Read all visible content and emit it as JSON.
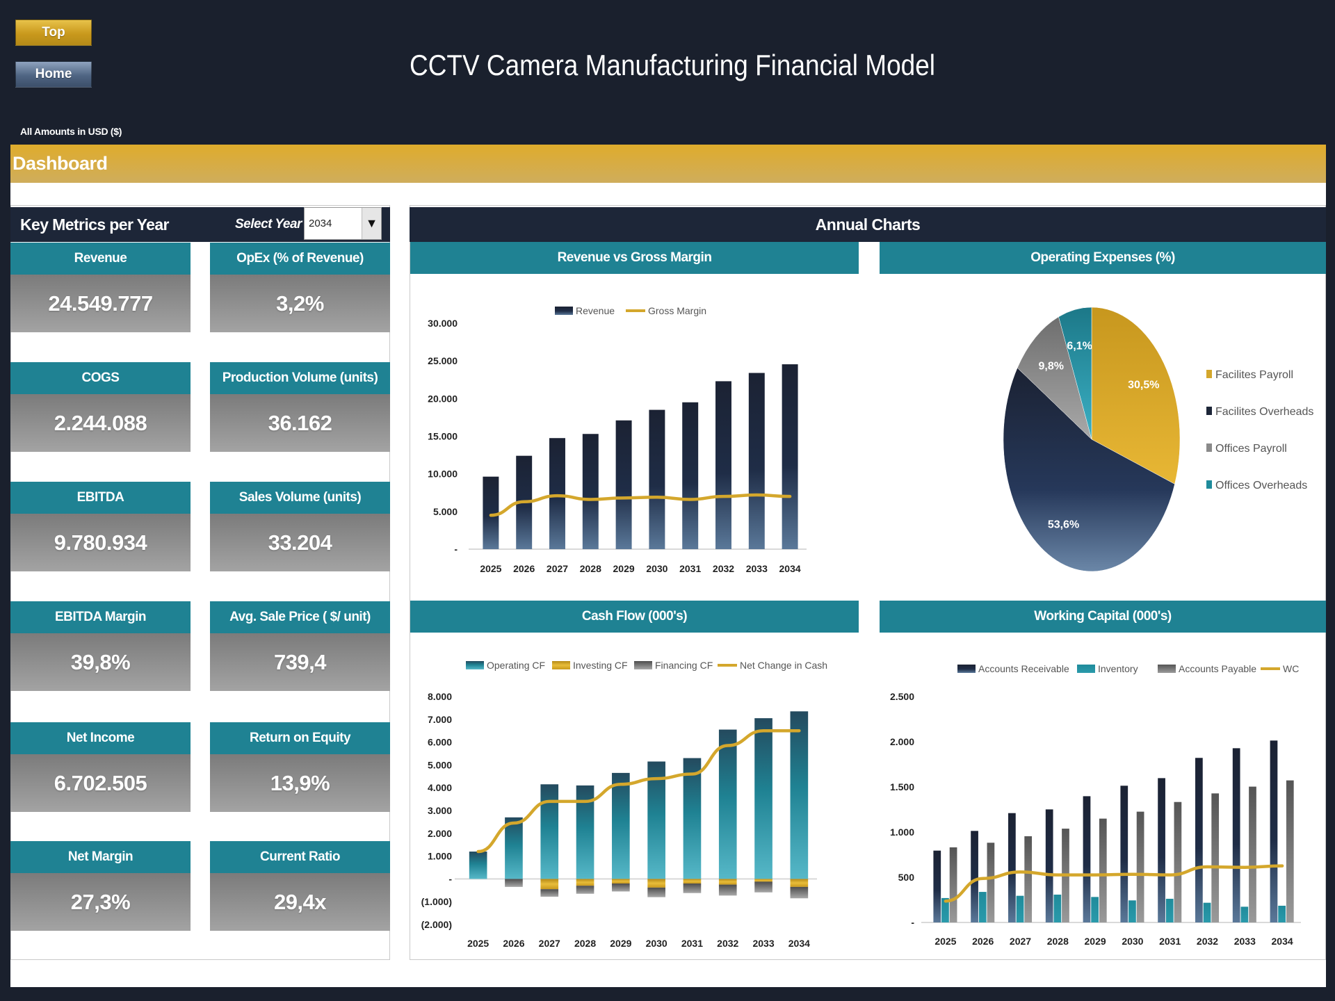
{
  "header": {
    "title": "CCTV Camera Manufacturing Financial Model",
    "buttons": {
      "top": "Top",
      "home": "Home"
    },
    "currency_note": "All Amounts in  USD ($)",
    "section_title": "Dashboard"
  },
  "colors": {
    "navy": "#1d2638",
    "teal": "#1f8293",
    "gold": "#d4a72c",
    "gray": "#8a8a8a",
    "background": "#1a202d"
  },
  "key_metrics": {
    "title": "Key Metrics per Year",
    "select_label": "Select Year",
    "selected_year": "2034",
    "items": [
      {
        "label": "Revenue",
        "value": "24.549.777"
      },
      {
        "label": "OpEx (% of Revenue)",
        "value": "3,2%"
      },
      {
        "label": "COGS",
        "value": "2.244.088"
      },
      {
        "label": "Production Volume (units)",
        "value": "36.162"
      },
      {
        "label": "EBITDA",
        "value": "9.780.934"
      },
      {
        "label": "Sales Volume (units)",
        "value": "33.204"
      },
      {
        "label": "EBITDA Margin",
        "value": "39,8%"
      },
      {
        "label": "Avg. Sale Price ( $/ unit)",
        "value": "739,4"
      },
      {
        "label": "Net Income",
        "value": "6.702.505"
      },
      {
        "label": "Return on Equity",
        "value": "13,9%"
      },
      {
        "label": "Net Margin",
        "value": "27,3%"
      },
      {
        "label": "Current Ratio",
        "value": "29,4x"
      }
    ]
  },
  "annual_charts_title": "Annual Charts",
  "chart_data": [
    {
      "id": "revenue",
      "type": "bar",
      "title": "Revenue vs Gross Margin",
      "categories": [
        "2025",
        "2026",
        "2027",
        "2028",
        "2029",
        "2030",
        "2031",
        "2032",
        "2033",
        "2034"
      ],
      "series": [
        {
          "name": "Revenue",
          "kind": "bar",
          "values": [
            9630,
            12400,
            14750,
            15300,
            17100,
            18500,
            19500,
            22300,
            23400,
            24550
          ]
        },
        {
          "name": "Gross Margin",
          "kind": "line",
          "values": [
            4500,
            6300,
            7100,
            6600,
            6800,
            6900,
            6600,
            7000,
            7200,
            7000
          ]
        }
      ],
      "yticks": [
        "-",
        "5.000",
        "10.000",
        "15.000",
        "20.000",
        "25.000",
        "30.000"
      ],
      "ylim": [
        0,
        30000
      ],
      "legend": "top"
    },
    {
      "id": "opex",
      "type": "pie",
      "title": "Operating Expenses (%)",
      "labels": [
        "Facilites Payroll",
        "Facilites Overheads",
        "Offices Payroll",
        "Offices Overheads"
      ],
      "values": [
        30.5,
        53.6,
        9.8,
        6.1
      ],
      "data_labels": [
        "30,5%",
        "53,6%",
        "9,8%",
        "6,1%"
      ],
      "legend": "right"
    },
    {
      "id": "cashflow",
      "type": "bar",
      "title": "Cash Flow (000's)",
      "categories": [
        "2025",
        "2026",
        "2027",
        "2028",
        "2029",
        "2030",
        "2031",
        "2032",
        "2033",
        "2034"
      ],
      "series": [
        {
          "name": "Operating CF",
          "kind": "bar",
          "values": [
            1200,
            2700,
            4150,
            4100,
            4650,
            5150,
            5300,
            6550,
            7050,
            7350
          ]
        },
        {
          "name": "Investing CF",
          "kind": "bar",
          "values": [
            0,
            0,
            -450,
            -300,
            -200,
            -380,
            -200,
            -250,
            -120,
            -350
          ]
        },
        {
          "name": "Financing CF",
          "kind": "bar",
          "values": [
            0,
            -350,
            -330,
            -350,
            -350,
            -420,
            -420,
            -480,
            -470,
            -500
          ]
        },
        {
          "name": "Net Change in Cash",
          "kind": "line",
          "values": [
            1200,
            2450,
            3400,
            3400,
            4150,
            4400,
            4600,
            5850,
            6500,
            6500
          ]
        }
      ],
      "yticks": [
        "(2.000)",
        "(1.000)",
        "-",
        "1.000",
        "2.000",
        "3.000",
        "4.000",
        "5.000",
        "6.000",
        "7.000",
        "8.000"
      ],
      "ylim": [
        -2000,
        8000
      ],
      "legend": "top"
    },
    {
      "id": "workingcapital",
      "type": "bar",
      "title": "Working Capital (000's)",
      "categories": [
        "2025",
        "2026",
        "2027",
        "2028",
        "2029",
        "2030",
        "2031",
        "2032",
        "2033",
        "2034"
      ],
      "series": [
        {
          "name": "Accounts Receivable",
          "kind": "bar",
          "values": [
            795,
            1013,
            1210,
            1251,
            1397,
            1513,
            1597,
            1821,
            1928,
            2013
          ]
        },
        {
          "name": "Inventory",
          "kind": "bar",
          "values": [
            270,
            338,
            295,
            308,
            282,
            244,
            262,
            218,
            174,
            185
          ]
        },
        {
          "name": "Accounts Payable",
          "kind": "bar",
          "values": [
            831,
            882,
            954,
            1038,
            1149,
            1226,
            1333,
            1428,
            1503,
            1572
          ]
        },
        {
          "name": "WC",
          "kind": "line",
          "values": [
            236,
            487,
            559,
            526,
            526,
            533,
            526,
            615,
            610,
            626
          ]
        }
      ],
      "yticks": [
        "-",
        "500",
        "1.000",
        "1.500",
        "2.000",
        "2.500"
      ],
      "ylim": [
        0,
        2500
      ],
      "legend": "top"
    }
  ]
}
